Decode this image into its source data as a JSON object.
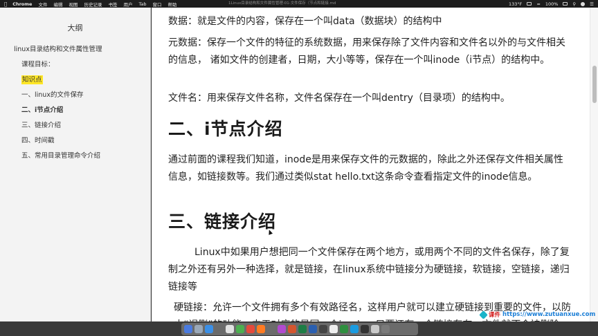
{
  "menubar": {
    "app": "Chrome",
    "items": [
      "文件",
      "编辑",
      "视图",
      "历史记录",
      "书签",
      "用户",
      "Tab",
      "窗口",
      "帮助"
    ],
    "window_title": "1Linux目录结构和文件属性管理-01-文件保存（节点和链接.md",
    "status": {
      "memory": "133°F",
      "battery": "100%"
    }
  },
  "sidebar": {
    "title": "大纲",
    "items": [
      {
        "label": "linux目录结构和文件属性管理",
        "level": 1
      },
      {
        "label": "课程目标：",
        "level": 2
      },
      {
        "label": "知识点",
        "level": 2,
        "highlight": true
      },
      {
        "label": "一、linux的文件保存",
        "level": 2
      },
      {
        "label": "二、i节点介绍",
        "level": 2,
        "bold": true
      },
      {
        "label": "三、链接介绍",
        "level": 2
      },
      {
        "label": "四、时间戳",
        "level": 2
      },
      {
        "label": "五、常用目录管理命令介绍",
        "level": 2
      }
    ]
  },
  "doc": {
    "p_data": "数据：就是文件的内容，保存在一个叫data（数据块）的结构中",
    "p_meta": "元数据：保存一个文件的特征的系统数据，用来保存除了文件内容和文件名以外的与文件相关的信息， 诸如文件的创建者，日期，大小等等，保存在一个叫inode（i节点）的结构中。",
    "p_name": "文件名：用来保存文件名称，文件名保存在一个叫dentry（目录项）的结构中。",
    "h_inode": "二、i节点介绍",
    "p_inode": "通过前面的课程我们知道，inode是用来保存文件的元数据的，除此之外还保存文件相关属性信息，如链接数等。我们通过类似stat hello.txt这条命令查看指定文件的inode信息。",
    "h_link": "三、链接介绍",
    "p_link": "Linux中如果用户想把同一个文件保存在两个地方，或用两个不同的文件名保存，除了复制之外还有另外一种选择，就是链接，在linux系统中链接分为硬链接，软链接，空链接，递归链接等",
    "p_hard": "硬链接：允许一个文件拥有多个有效路径名，这样用户就可以建立硬链接到重要的文件，以防止“误删”的功能。由于对应的是同一个inode，只要还有一个链接存在，文件就不会被删除。只有当最后一个链接被删除后，文件的数据块及目录的连接才会被释放。"
  },
  "watermark": {
    "label": "课件",
    "url": "https://www.zutuanxue.com"
  },
  "colors": {
    "highlight": "#ffe626",
    "watermark_red": "#d21b1b",
    "watermark_blue": "#1d7fd6"
  }
}
